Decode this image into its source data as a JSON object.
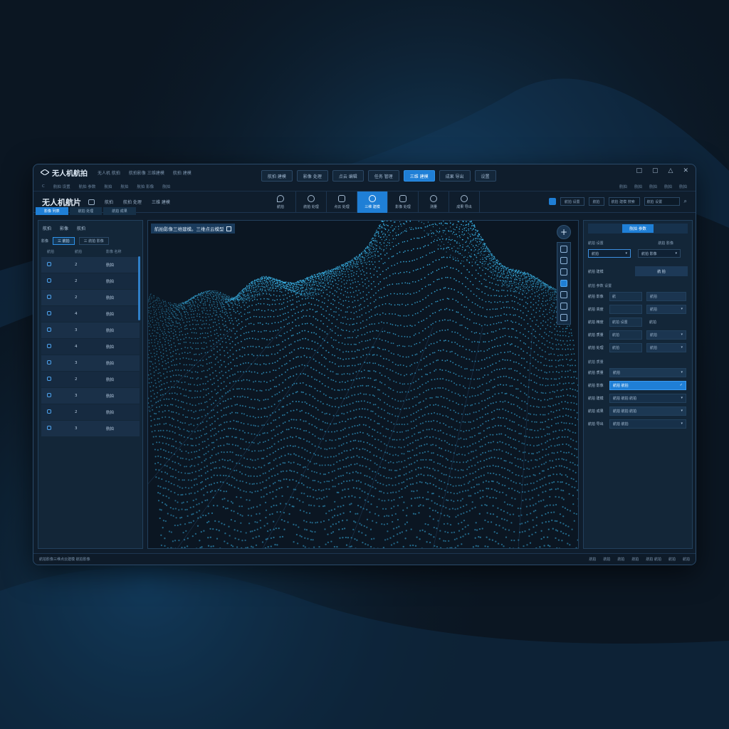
{
  "app": {
    "logo_text": "无人机航拍",
    "title_meta": [
      "无人机 航拍",
      "航拍影像 三维建模",
      "航拍 建模"
    ],
    "top_tabs": [
      "航拍 建模",
      "影像 处理",
      "点云 编辑",
      "任务 管理",
      "三维 建模",
      "成果 导出",
      "设置"
    ],
    "active_top_tab": 4,
    "window_controls": [
      "□",
      "▢",
      "△",
      "✕"
    ],
    "subbar_left": [
      "C",
      "航拍 设置",
      "航拍 参数",
      "航拍",
      "航拍",
      "航拍 影像",
      "航拍"
    ],
    "subbar_right": [
      "航拍",
      "航拍",
      "航拍",
      "航拍",
      "航拍"
    ]
  },
  "header": {
    "title": "无人机航片",
    "links": [
      "航拍",
      "航拍 处理",
      "三维 建模"
    ],
    "tools": [
      {
        "label": "航拍",
        "icon": "location-pin-icon"
      },
      {
        "label": "航拍 处理",
        "icon": "map-pin-icon"
      },
      {
        "label": "点云 处理",
        "icon": "columns-icon"
      },
      {
        "label": "三维 建模",
        "icon": "mesh-icon"
      },
      {
        "label": "影像 处理",
        "icon": "image-icon"
      },
      {
        "label": "测量",
        "icon": "measure-icon"
      },
      {
        "label": "成果 导出",
        "icon": "export-icon"
      }
    ],
    "active_tool": 3,
    "search_buttons": [
      "航拍 设置",
      "航拍"
    ],
    "search_placeholder": "航拍 建模 搜索",
    "second_input": "航拍 设置"
  },
  "strip": [
    "影像 列表",
    "航拍 处理",
    "航拍 成果"
  ],
  "left_panel": {
    "tabs": [
      "航拍",
      "影像",
      "航拍"
    ],
    "filters": [
      "影像",
      "三 航拍",
      "三 航拍 影像"
    ],
    "columns": [
      "航拍",
      "航拍",
      "影像 名称"
    ],
    "rows": [
      {
        "idx": "2",
        "name": "航拍"
      },
      {
        "idx": "2",
        "name": "航拍"
      },
      {
        "idx": "2",
        "name": "航拍"
      },
      {
        "idx": "4",
        "name": "航拍"
      },
      {
        "idx": "3",
        "name": "航拍"
      },
      {
        "idx": "4",
        "name": "航拍"
      },
      {
        "idx": "3",
        "name": "航拍"
      },
      {
        "idx": "2",
        "name": "航拍"
      },
      {
        "idx": "3",
        "name": "航拍"
      },
      {
        "idx": "2",
        "name": "航拍"
      },
      {
        "idx": "3",
        "name": "航拍"
      }
    ]
  },
  "viewport": {
    "label": "航拍影像三维建模。三维点云模型"
  },
  "right_panel": {
    "tab": "航拍 参数",
    "col_headers": [
      "航拍 设置",
      "航拍 影像"
    ],
    "selects": [
      "航拍",
      "航拍 影像"
    ],
    "button_label": "航拍 建模",
    "button_text": "航 拍",
    "section1": "航拍 参数 设置",
    "rows1": [
      {
        "label": "航拍 影像",
        "v1": "航",
        "v2": "航拍"
      },
      {
        "label": "航拍 高度",
        "v1": "",
        "v2": "航拍"
      },
      {
        "label": "航拍 精度",
        "v1": "航拍 设置",
        "v2": "航拍"
      },
      {
        "label": "航拍 质量",
        "v1": "航拍",
        "v2": "航拍"
      },
      {
        "label": "航拍 处理",
        "v1": "航拍",
        "v2": "航拍"
      }
    ],
    "section2": "航拍 质量",
    "rows2": [
      {
        "label": "航拍 质量",
        "value": "航拍"
      },
      {
        "label": "航拍 影像",
        "value": "航拍 航拍"
      },
      {
        "label": "航拍 建模",
        "value": "航拍 航拍 航拍"
      },
      {
        "label": "航拍 成果",
        "value": "航拍 航拍 航拍"
      },
      {
        "label": "航拍 导出",
        "value": "航拍 航拍"
      }
    ],
    "active_row2": 1
  },
  "status": {
    "left": "航拍影像三维点云建模 航拍影像",
    "right": [
      "航拍",
      "航拍",
      "航拍",
      "航拍",
      "航拍 航拍",
      "航拍",
      "航拍"
    ]
  },
  "colors": {
    "accent": "#1f7fd6",
    "point_cloud": "#3fc6ff",
    "bg": "#0b1622"
  }
}
